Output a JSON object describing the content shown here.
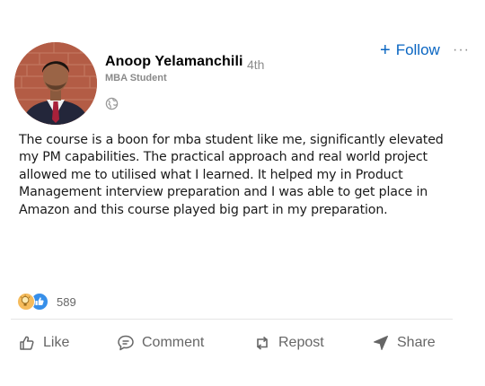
{
  "author": {
    "name": "Anoop Yelamanchili",
    "degree": "4th",
    "headline": "MBA Student"
  },
  "header": {
    "follow_label": "Follow",
    "more_label": "···"
  },
  "post": {
    "text": "The course is a boon for mba student like me, significantly elevated my PM capabilities. The practical approach and real world project allowed me to utilised what I learned. It helped my in Product Management interview preparation and I was able to get place in Amazon and this course played big part in my preparation."
  },
  "reactions": {
    "count": "589",
    "types": [
      "insightful-icon",
      "like-icon"
    ]
  },
  "actions": {
    "like": "Like",
    "comment": "Comment",
    "repost": "Repost",
    "share": "Share"
  },
  "colors": {
    "accent": "#0a66c2",
    "muted": "#666666",
    "like_blue": "#378fe9",
    "insightful_yellow": "#f5bb5c"
  }
}
